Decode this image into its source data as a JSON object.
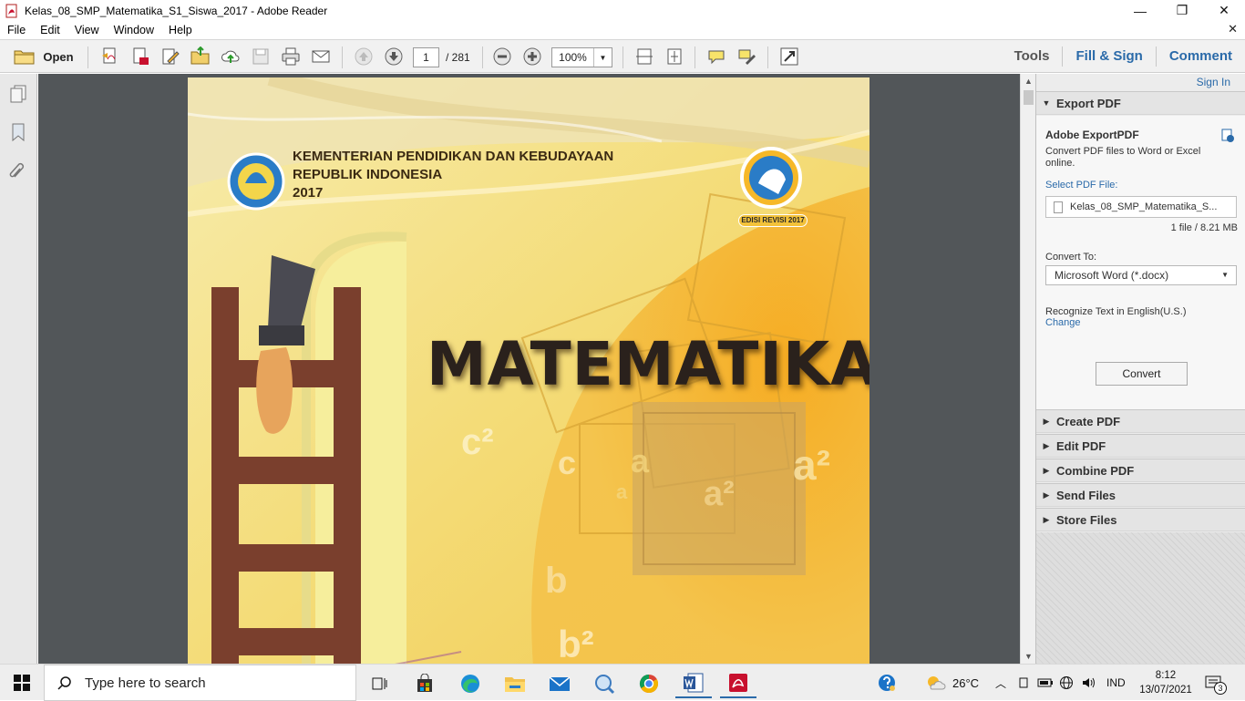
{
  "window": {
    "title": "Kelas_08_SMP_Matematika_S1_Siswa_2017 - Adobe Reader",
    "minimize": "—",
    "maximize": "❐",
    "close": "✕"
  },
  "menu": {
    "items": [
      "File",
      "Edit",
      "View",
      "Window",
      "Help"
    ],
    "close_doc": "✕"
  },
  "toolbar": {
    "open_label": "Open",
    "page_current": "1",
    "page_total": "/ 281",
    "zoom": "100%",
    "tools_label": "Tools",
    "fill_sign_label": "Fill & Sign",
    "comment_label": "Comment"
  },
  "cover": {
    "ministry_line1": "KEMENTERIAN PENDIDIKAN DAN KEBUDAYAAN",
    "ministry_line2": "REPUBLIK INDONESIA",
    "year": "2017",
    "title": "MATEMATIKA",
    "edition_badge": "EDISI REVISI 2017",
    "math_symbols": [
      "c²",
      "c",
      "a",
      "a",
      "a²",
      "a²",
      "b",
      "b²"
    ]
  },
  "right_pane": {
    "sign_in": "Sign In",
    "export_pdf": {
      "header": "Export PDF",
      "title": "Adobe ExportPDF",
      "description": "Convert PDF files to Word or Excel online.",
      "select_label": "Select PDF File:",
      "file_name": "Kelas_08_SMP_Matematika_S...",
      "file_info": "1 file / 8.21 MB",
      "convert_to_label": "Convert To:",
      "convert_to_value": "Microsoft Word (*.docx)",
      "recognize_text": "Recognize Text in English(U.S.)",
      "change_link": "Change",
      "convert_button": "Convert"
    },
    "sections": [
      "Create PDF",
      "Edit PDF",
      "Combine PDF",
      "Send Files",
      "Store Files"
    ]
  },
  "taskbar": {
    "search_placeholder": "Type here to search",
    "weather": "26°C",
    "language": "IND",
    "time": "8:12",
    "date": "13/07/2021",
    "notifications": "3"
  },
  "colors": {
    "accent": "#2a6aa9",
    "doc_bg": "#525659",
    "cover_yellow": "#f3e27a",
    "cover_orange": "#f6b828"
  }
}
